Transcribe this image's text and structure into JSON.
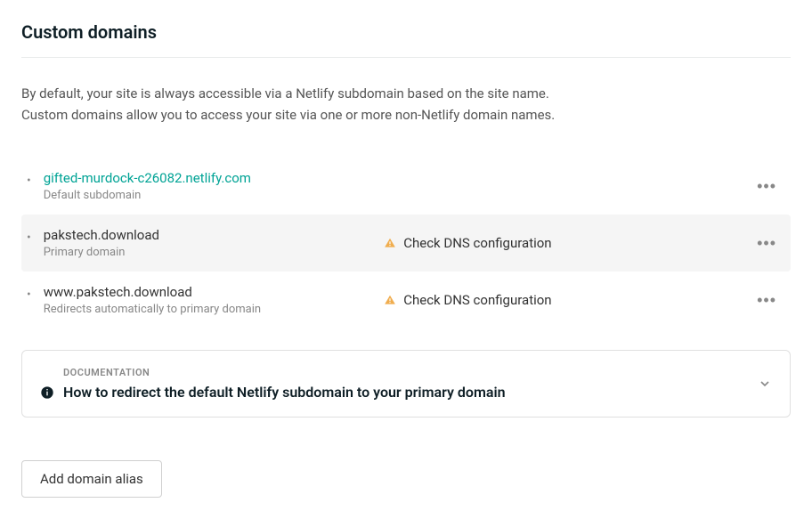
{
  "section": {
    "title": "Custom domains",
    "description_line1": "By default, your site is always accessible via a Netlify subdomain based on the site name.",
    "description_line2": "Custom domains allow you to access your site via one or more non-Netlify domain names."
  },
  "domains": [
    {
      "name": "gifted-murdock-c26082.netlify.com",
      "subtext": "Default subdomain",
      "is_link": true,
      "status": null,
      "highlighted": false
    },
    {
      "name": "pakstech.download",
      "subtext": "Primary domain",
      "is_link": false,
      "status": "Check DNS configuration",
      "highlighted": true
    },
    {
      "name": "www.pakstech.download",
      "subtext": "Redirects automatically to primary domain",
      "is_link": false,
      "status": "Check DNS configuration",
      "highlighted": false
    }
  ],
  "documentation": {
    "label": "DOCUMENTATION",
    "title": "How to redirect the default Netlify subdomain to your primary domain"
  },
  "actions": {
    "add_alias": "Add domain alias"
  }
}
